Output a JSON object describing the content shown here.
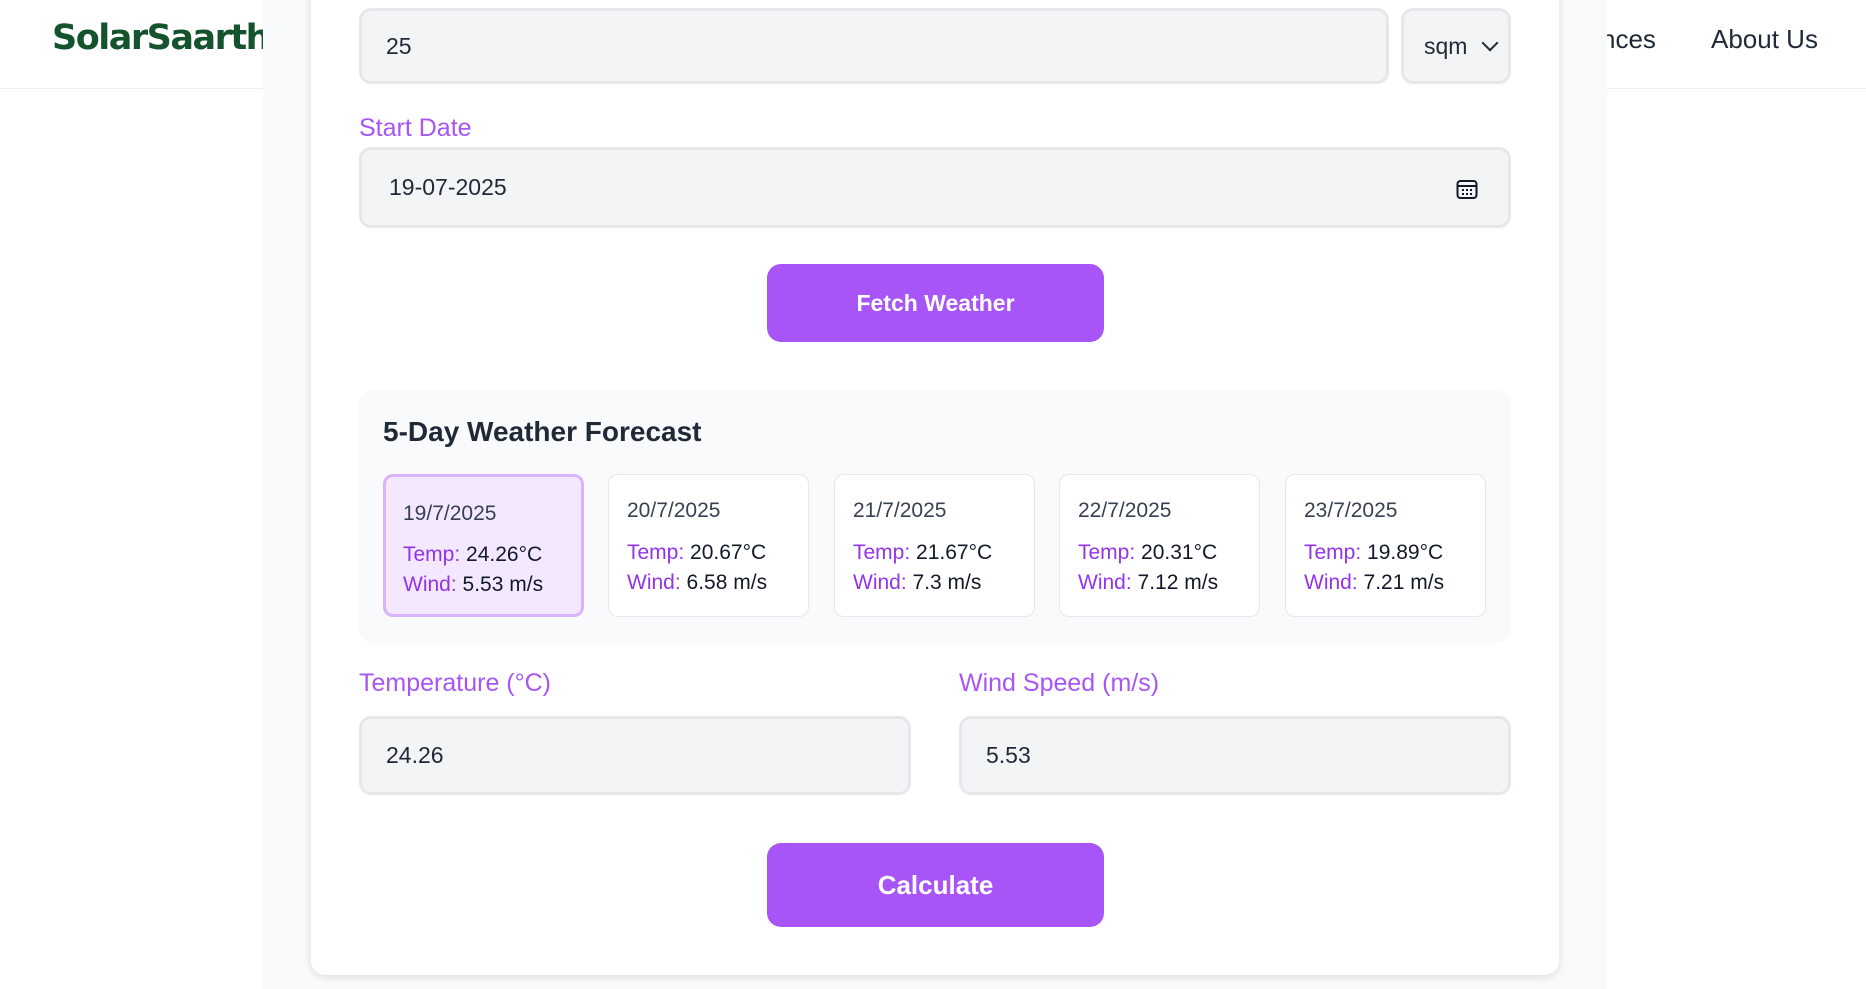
{
  "nav": {
    "logo": "SolarSaarthi",
    "links": [
      "nces",
      "About Us"
    ]
  },
  "form": {
    "area_value": "25",
    "area_unit": "sqm",
    "start_date_label": "Start Date",
    "start_date_value": "19-07-2025",
    "fetch_button": "Fetch Weather",
    "temperature_label": "Temperature (°C)",
    "temperature_value": "24.26",
    "wind_label": "Wind Speed (m/s)",
    "wind_value": "5.53",
    "calculate_button": "Calculate"
  },
  "forecast": {
    "title": "5-Day Weather Forecast",
    "temp_key": "Temp:",
    "wind_key": "Wind:",
    "days": [
      {
        "date": "19/7/2025",
        "temp": "24.26°C",
        "wind": "5.53 m/s",
        "selected": true
      },
      {
        "date": "20/7/2025",
        "temp": "20.67°C",
        "wind": "6.58 m/s",
        "selected": false
      },
      {
        "date": "21/7/2025",
        "temp": "21.67°C",
        "wind": "7.3 m/s",
        "selected": false
      },
      {
        "date": "22/7/2025",
        "temp": "20.31°C",
        "wind": "7.12 m/s",
        "selected": false
      },
      {
        "date": "23/7/2025",
        "temp": "19.89°C",
        "wind": "7.21 m/s",
        "selected": false
      }
    ]
  },
  "icons": {
    "calendar": "calendar-icon",
    "select_chevron": "chevron-down-icon"
  },
  "colors": {
    "accent": "#a855f7",
    "brand": "#14532d"
  }
}
